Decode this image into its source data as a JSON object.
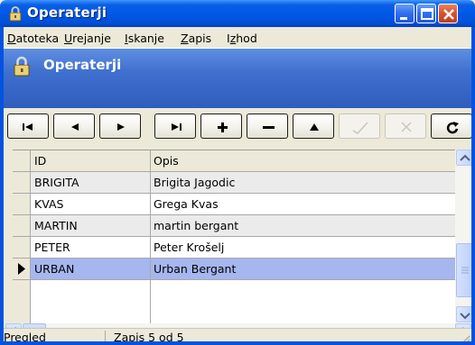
{
  "window": {
    "title": "Operaterji",
    "icon": "lock-icon"
  },
  "menu": {
    "items": [
      "Datoteka",
      "Urejanje",
      "Iskanje",
      "Zapis",
      "Izhod"
    ],
    "underline": [
      "D",
      "U",
      "I",
      "Z",
      "z"
    ]
  },
  "banner": {
    "title": "Operaterji",
    "icon": "lock-icon"
  },
  "toolbar": {
    "buttons": [
      {
        "name": "first-record-icon",
        "enabled": true
      },
      {
        "name": "prior-record-icon",
        "enabled": true
      },
      {
        "name": "next-record-icon",
        "enabled": true
      },
      {
        "name": "last-record-icon",
        "enabled": true
      },
      {
        "name": "insert-record-icon",
        "enabled": true
      },
      {
        "name": "delete-record-icon",
        "enabled": true
      },
      {
        "name": "edit-record-icon",
        "enabled": true
      },
      {
        "name": "post-record-icon",
        "enabled": false
      },
      {
        "name": "cancel-edit-icon",
        "enabled": false
      },
      {
        "name": "refresh-icon",
        "enabled": true
      }
    ]
  },
  "grid": {
    "columns": [
      "ID",
      "Opis"
    ],
    "rows": [
      {
        "id": "BRIGITA",
        "opis": "Brigita Jagodic"
      },
      {
        "id": "KVAS",
        "opis": "Grega Kvas"
      },
      {
        "id": "MARTIN",
        "opis": "martin bergant"
      },
      {
        "id": "PETER",
        "opis": "Peter Krošelj"
      },
      {
        "id": "URBAN",
        "opis": "Urban Bergant"
      }
    ],
    "selected_index": 4
  },
  "status": {
    "mode": "Pregled",
    "record": "Zapis 5 od 5"
  },
  "colors": {
    "titlebar": "#0058e6",
    "banner": "#3f6fcf",
    "selected_row": "#a6b6ee",
    "alt_row": "#ebebeb"
  }
}
